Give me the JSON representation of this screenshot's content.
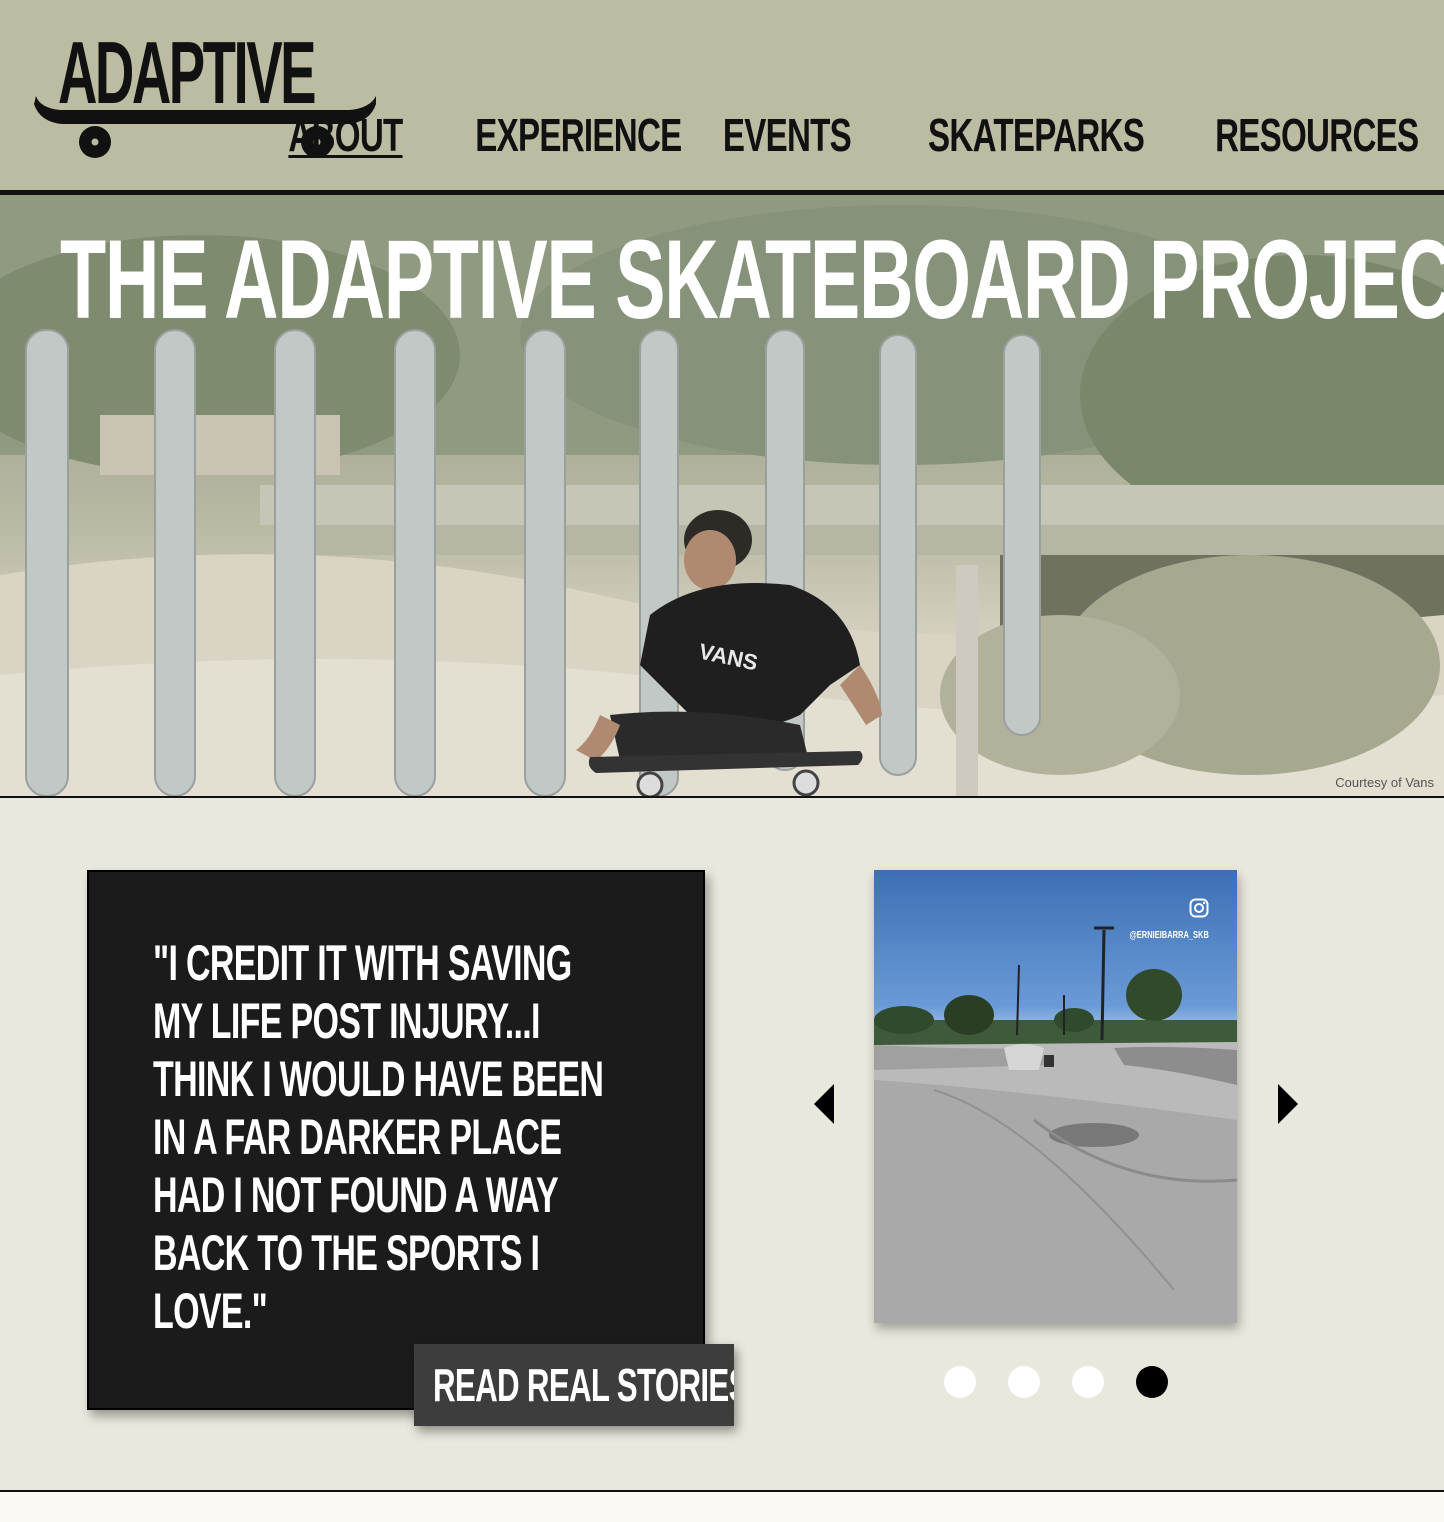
{
  "header": {
    "logo_text": "ADAPTIVE",
    "nav": [
      {
        "label": "ABOUT",
        "active": true
      },
      {
        "label": "EXPERIENCE",
        "active": false
      },
      {
        "label": "EVENTS",
        "active": false
      },
      {
        "label": "SKATEPARKS",
        "active": false
      },
      {
        "label": "RESOURCES",
        "active": false
      }
    ]
  },
  "hero": {
    "title": "THE ADAPTIVE SKATEBOARD PROJECT",
    "credit": "Courtesy of Vans",
    "shirt_logo": "VANS"
  },
  "quote": {
    "text": "\"I CREDIT IT WITH SAVING MY LIFE POST INJURY...I THINK I WOULD HAVE BEEN IN A FAR DARKER PLACE HAD I NOT FOUND A WAY BACK TO THE SPORTS I LOVE.\"",
    "button_label": "READ REAL STORIES"
  },
  "carousel": {
    "ig_handle": "@ERNIEIBARRA_SKB",
    "ig_icon": "instagram-icon",
    "total_slides": 4,
    "active_slide": 4
  },
  "colors": {
    "header_bg": "#bcbca2",
    "page_bg": "#e9e8dc",
    "quote_bg": "#1b1b1b",
    "button_bg": "#3d3d3d"
  }
}
